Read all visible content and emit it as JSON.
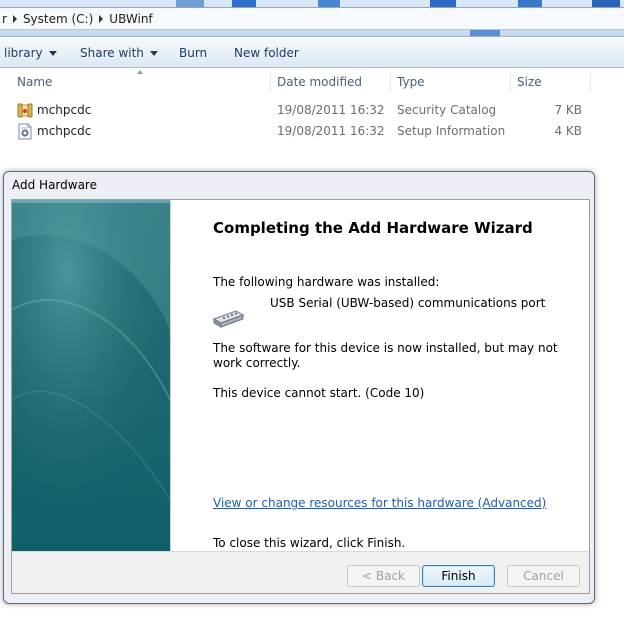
{
  "explorer": {
    "breadcrumb": {
      "partial": "r",
      "items": [
        "System (C:)",
        "UBWinf"
      ]
    },
    "toolbar": {
      "library_label": "library",
      "share_label": "Share with",
      "burn_label": "Burn",
      "new_folder_label": "New folder"
    },
    "columns": {
      "name": "Name",
      "date_modified": "Date modified",
      "type": "Type",
      "size": "Size"
    },
    "files": [
      {
        "name": "mchpcdc",
        "date": "19/08/2011 16:32",
        "type": "Security Catalog",
        "size": "7 KB",
        "icon": "security-catalog-icon"
      },
      {
        "name": "mchpcdc",
        "date": "19/08/2011 16:32",
        "type": "Setup Information",
        "size": "4 KB",
        "icon": "setup-information-icon"
      }
    ]
  },
  "dialog": {
    "title": "Add Hardware",
    "heading": "Completing the Add Hardware Wizard",
    "installed_label": "The following hardware was installed:",
    "device_name": "USB Serial (UBW-based) communications port",
    "device_icon": "serial-port-icon",
    "status_text": "The software for this device is now installed, but may not work correctly.",
    "error_text": "This device cannot start. (Code 10)",
    "resources_link": "View or change resources for this hardware (Advanced)",
    "close_hint": "To close this wizard, click Finish.",
    "buttons": {
      "back": "< Back",
      "finish": "Finish",
      "cancel": "Cancel"
    }
  },
  "colors": {
    "side_panel": "#1f6970",
    "link": "#1a5fb4",
    "dialog_frame": "#ecf0f6"
  }
}
